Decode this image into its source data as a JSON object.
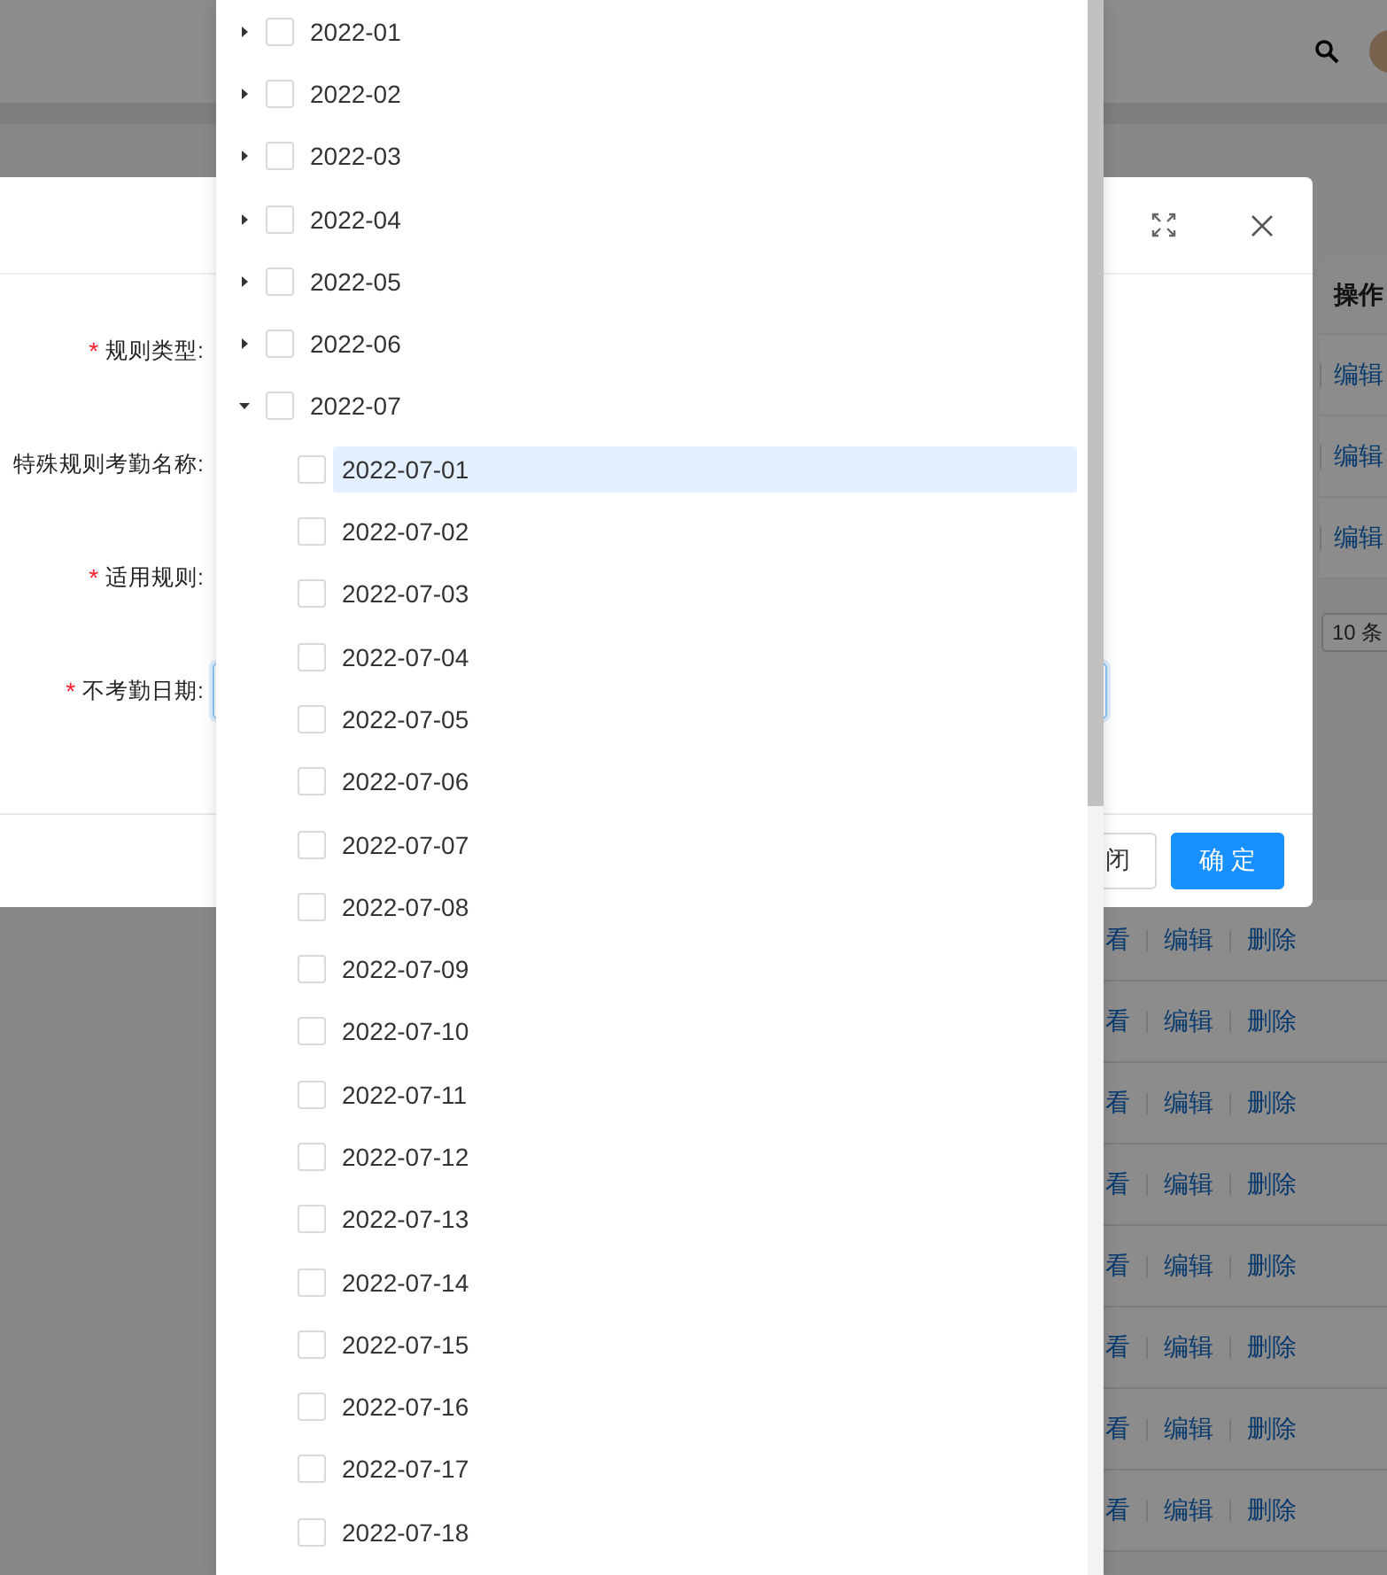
{
  "background_table": {
    "column_header": "操作",
    "rows": [
      {
        "action": "编辑"
      },
      {
        "action": "编辑"
      },
      {
        "action": "编辑"
      }
    ]
  },
  "pagination": {
    "page_size": "10 条"
  },
  "list_rows": [
    {
      "actions": [
        "看",
        "编辑",
        "删除"
      ]
    },
    {
      "actions": [
        "看",
        "编辑",
        "删除"
      ]
    },
    {
      "actions": [
        "看",
        "编辑",
        "删除"
      ]
    },
    {
      "actions": [
        "看",
        "编辑",
        "删除"
      ]
    },
    {
      "actions": [
        "看",
        "编辑",
        "删除"
      ]
    },
    {
      "actions": [
        "看",
        "编辑",
        "删除"
      ]
    },
    {
      "actions": [
        "看",
        "编辑",
        "删除"
      ]
    },
    {
      "actions": [
        "看",
        "编辑",
        "删除"
      ]
    }
  ],
  "dialog": {
    "fields": [
      {
        "label": "规则类型:",
        "required_mark": "*",
        "kind": "hidden"
      },
      {
        "label": "特殊规则考勤名称:",
        "kind": "hidden"
      },
      {
        "label": "适用规则:",
        "required_mark": "*",
        "kind": "hidden"
      },
      {
        "label": "不考勤日期:",
        "required_mark": "*",
        "kind": "input"
      }
    ],
    "buttons": [
      {
        "label": "闭",
        "kind": "default"
      },
      {
        "label": "确 定",
        "kind": "primary"
      }
    ]
  },
  "date_tree": {
    "nodes": [
      {
        "label": "2022-01",
        "expanded": false,
        "checked": false,
        "selected": false
      },
      {
        "label": "2022-02",
        "expanded": false,
        "checked": false,
        "selected": false
      },
      {
        "label": "2022-03",
        "expanded": false,
        "checked": false,
        "selected": false
      },
      {
        "label": "2022-04",
        "expanded": false,
        "checked": false,
        "selected": false
      },
      {
        "label": "2022-05",
        "expanded": false,
        "checked": false,
        "selected": false
      },
      {
        "label": "2022-06",
        "expanded": false,
        "checked": false,
        "selected": false
      },
      {
        "label": "2022-07",
        "expanded": true,
        "checked": false,
        "selected": false,
        "children": [
          {
            "label": "2022-07-01",
            "checked": false,
            "selected": true
          },
          {
            "label": "2022-07-02",
            "checked": false,
            "selected": false
          },
          {
            "label": "2022-07-03",
            "checked": false,
            "selected": false
          },
          {
            "label": "2022-07-04",
            "checked": false,
            "selected": false
          },
          {
            "label": "2022-07-05",
            "checked": false,
            "selected": false
          },
          {
            "label": "2022-07-06",
            "checked": false,
            "selected": false
          },
          {
            "label": "2022-07-07",
            "checked": false,
            "selected": false
          },
          {
            "label": "2022-07-08",
            "checked": false,
            "selected": false
          },
          {
            "label": "2022-07-09",
            "checked": false,
            "selected": false
          },
          {
            "label": "2022-07-10",
            "checked": false,
            "selected": false
          },
          {
            "label": "2022-07-11",
            "checked": false,
            "selected": false
          },
          {
            "label": "2022-07-12",
            "checked": false,
            "selected": false
          },
          {
            "label": "2022-07-13",
            "checked": false,
            "selected": false
          },
          {
            "label": "2022-07-14",
            "checked": false,
            "selected": false
          },
          {
            "label": "2022-07-15",
            "checked": false,
            "selected": false
          },
          {
            "label": "2022-07-16",
            "checked": false,
            "selected": false
          },
          {
            "label": "2022-07-17",
            "checked": false,
            "selected": false
          },
          {
            "label": "2022-07-18",
            "checked": false,
            "selected": false
          }
        ]
      }
    ]
  }
}
